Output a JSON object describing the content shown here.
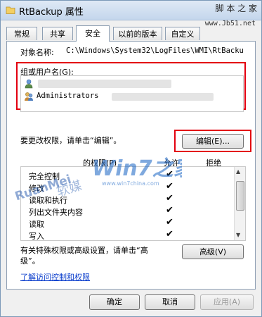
{
  "window": {
    "title": "RtBackup 属性",
    "watermark_top": "脚 本 之 家",
    "watermark_url": "www.Jb51.net"
  },
  "tabs": [
    {
      "label": "常规"
    },
    {
      "label": "共享"
    },
    {
      "label": "安全"
    },
    {
      "label": "以前的版本"
    },
    {
      "label": "自定义"
    }
  ],
  "security": {
    "object_label": "对象名称:",
    "object_path": "C:\\Windows\\System32\\LogFiles\\WMI\\RtBacku",
    "group_label": "组或用户名(G):",
    "users": [
      {
        "name": ""
      },
      {
        "name": "Administrators"
      }
    ],
    "change_perm_text": "要更改权限，请单击“编辑”。",
    "edit_button": "编辑(E)...",
    "perm_header": "的权限(P)",
    "allow_header": "允许",
    "deny_header": "拒绝",
    "permissions": [
      {
        "name": "完全控制",
        "allow": "✔"
      },
      {
        "name": "修改",
        "allow": "✔"
      },
      {
        "name": "读取和执行",
        "allow": "✔"
      },
      {
        "name": "列出文件夹内容",
        "allow": "✔"
      },
      {
        "name": "读取",
        "allow": "✔"
      },
      {
        "name": "写入",
        "allow": "✔"
      }
    ],
    "special_text_1": "有关特殊权限或高级设置，请单击“高",
    "special_text_2": "级”。",
    "advanced_button": "高级(V)",
    "learn_link": "了解访问控制和权限"
  },
  "overlay": {
    "win7_logo": "Win7之家",
    "win7_url": "www.win7china.com",
    "ruanmei_logo": "RuanMei",
    "ruanmei_cn": "软媒"
  },
  "buttons": {
    "ok": "确定",
    "cancel": "取消",
    "apply": "应用(A)"
  }
}
